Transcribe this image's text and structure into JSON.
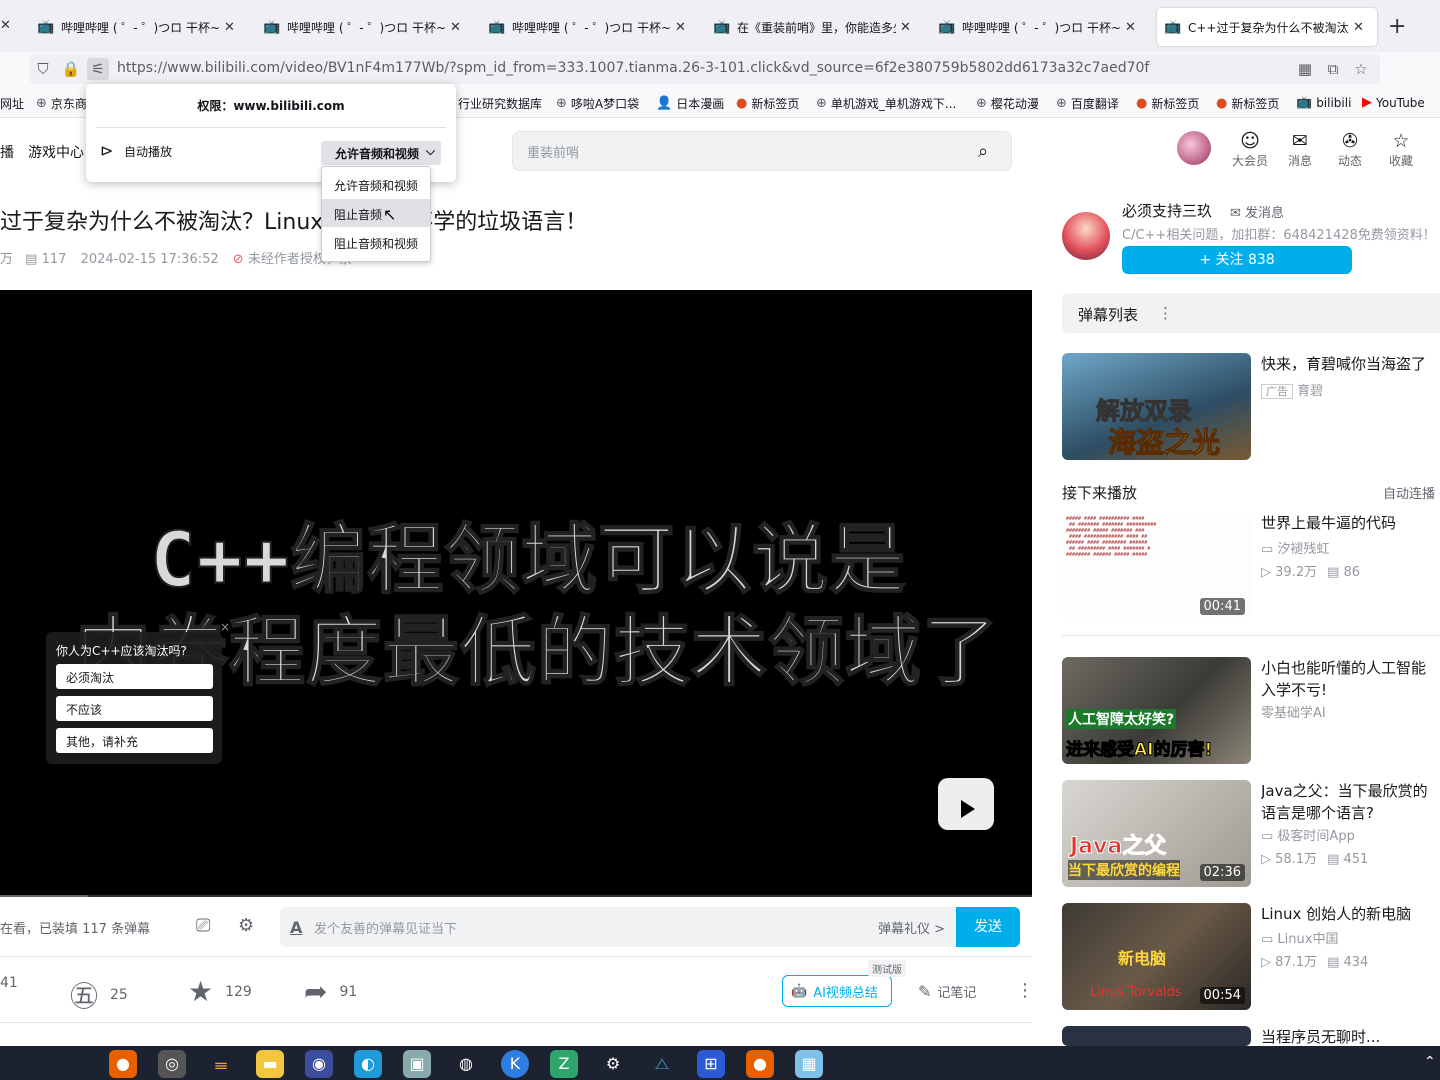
{
  "browser": {
    "tabs": [
      {
        "title": "哔哩哔哩 ( ゜- ゜)つロ 干杯~-bi",
        "active": false
      },
      {
        "title": "哔哩哔哩 ( ゜- ゜)つロ 干杯~-bi",
        "active": false
      },
      {
        "title": "哔哩哔哩 ( ゜- ゜)つロ 干杯~-bi",
        "active": false
      },
      {
        "title": "在《重装前哨》里，你能造多少",
        "active": false
      },
      {
        "title": "哔哩哔哩 ( ゜- ゜)つロ 干杯~-bi",
        "active": false
      },
      {
        "title": "C++过于复杂为什么不被淘汰?",
        "active": true
      }
    ],
    "new_tab": "+",
    "url": "https://www.bilibili.com/video/BV1nF4m177Wb/?spm_id_from=333.1007.tianma.26-3-101.click&vd_source=6f2e380759b5802dd6173a32c7aed70f",
    "bookmarks": [
      "网址",
      "京东商",
      "行业研究数据库",
      "哆啦A梦口袋",
      "日本漫画",
      "新标签页",
      "单机游戏_单机游戏下...",
      "樱花动漫",
      "百度翻译",
      "新标签页",
      "新标签页",
      "bilibili",
      "YouTube"
    ]
  },
  "permission_popup": {
    "title": "权限：www.bilibili.com",
    "autoplay_label": "自动播放",
    "selected": "允许音频和视频",
    "options": [
      "允许音频和视频",
      "阻止音频",
      "阻止音频和视频"
    ],
    "hovered_index": 1
  },
  "header": {
    "nav_left": [
      "播",
      "游戏中心"
    ],
    "search_placeholder": "重装前哨",
    "icons": [
      {
        "label": "大会员",
        "icon": "vip-icon"
      },
      {
        "label": "消息",
        "icon": "message-icon"
      },
      {
        "label": "动态",
        "icon": "dynamic-icon"
      },
      {
        "label": "收藏",
        "icon": "favorite-icon"
      }
    ]
  },
  "video": {
    "title": "过于复杂为什么不被淘汰？Linux之父口中不学的垃圾语言！",
    "danmaku_count": "117",
    "date": "2024-02-15 17:36:52",
    "copyright": "未经作者授权，禁",
    "view_prefix": "万",
    "subtitle_line1": "C++编程领域可以说是",
    "subtitle_line2": "内卷程度最低的技术领域了",
    "progress_fraction": 0.085
  },
  "poll": {
    "question": "你人为C++应该淘汰吗?",
    "options": [
      "必须淘汰",
      "不应该",
      "其他，请补充"
    ],
    "close": "×"
  },
  "danmaku_bar": {
    "viewers_text": "在看，已装填 117 条弹幕",
    "placeholder": "发个友善的弹幕见证当下",
    "etiquette": "弹幕礼仪 >",
    "send": "发送"
  },
  "actions": {
    "like": "41",
    "coin": "25",
    "favorite": "129",
    "share": "91",
    "ai_summary": "AI视频总结",
    "ai_badge": "测试版",
    "notes": "记笔记"
  },
  "uploader": {
    "name": "必须支持三玖",
    "message": "发消息",
    "description": "C/C++相关问题，加扣群：648421428免费领资料！",
    "follow": "+ 关注 838"
  },
  "sidebar": {
    "danmaku_list": "弹幕列表",
    "ad": {
      "title": "快来，育碧喊你当海盗了",
      "tag": "广告",
      "source": "育碧",
      "thumb_text1": "解放双录",
      "thumb_text2": "海盗之光"
    },
    "next_label": "接下来播放",
    "autoplay": "自动连播",
    "videos": [
      {
        "title": "世界上最牛逼的代码",
        "author": "汐褪残虹",
        "views": "39.2万",
        "danmaku": "86",
        "duration": "00:41"
      },
      {
        "title": "小白也能听懂的人工智能",
        "title2": "入学不亏!",
        "author": "零基础学AI",
        "thumb_text1": "人工智障太好笑?",
        "thumb_text2": "进来感受AI的厉害!"
      },
      {
        "title": "Java之父：当下最欣赏的",
        "title2": "语言是哪个语言?",
        "author": "极客时间App",
        "views": "58.1万",
        "danmaku": "451",
        "duration": "02:36",
        "thumb_text1": "Java之父",
        "thumb_text2": "当下最欣赏的编程"
      },
      {
        "title": "Linux 创始人的新电脑",
        "author": "Linux中国",
        "views": "87.1万",
        "danmaku": "434",
        "duration": "00:54",
        "thumb_text1": "新电脑",
        "thumb_text2": "Linus Torvalds"
      },
      {
        "title": "当程序员无聊时..."
      }
    ]
  }
}
